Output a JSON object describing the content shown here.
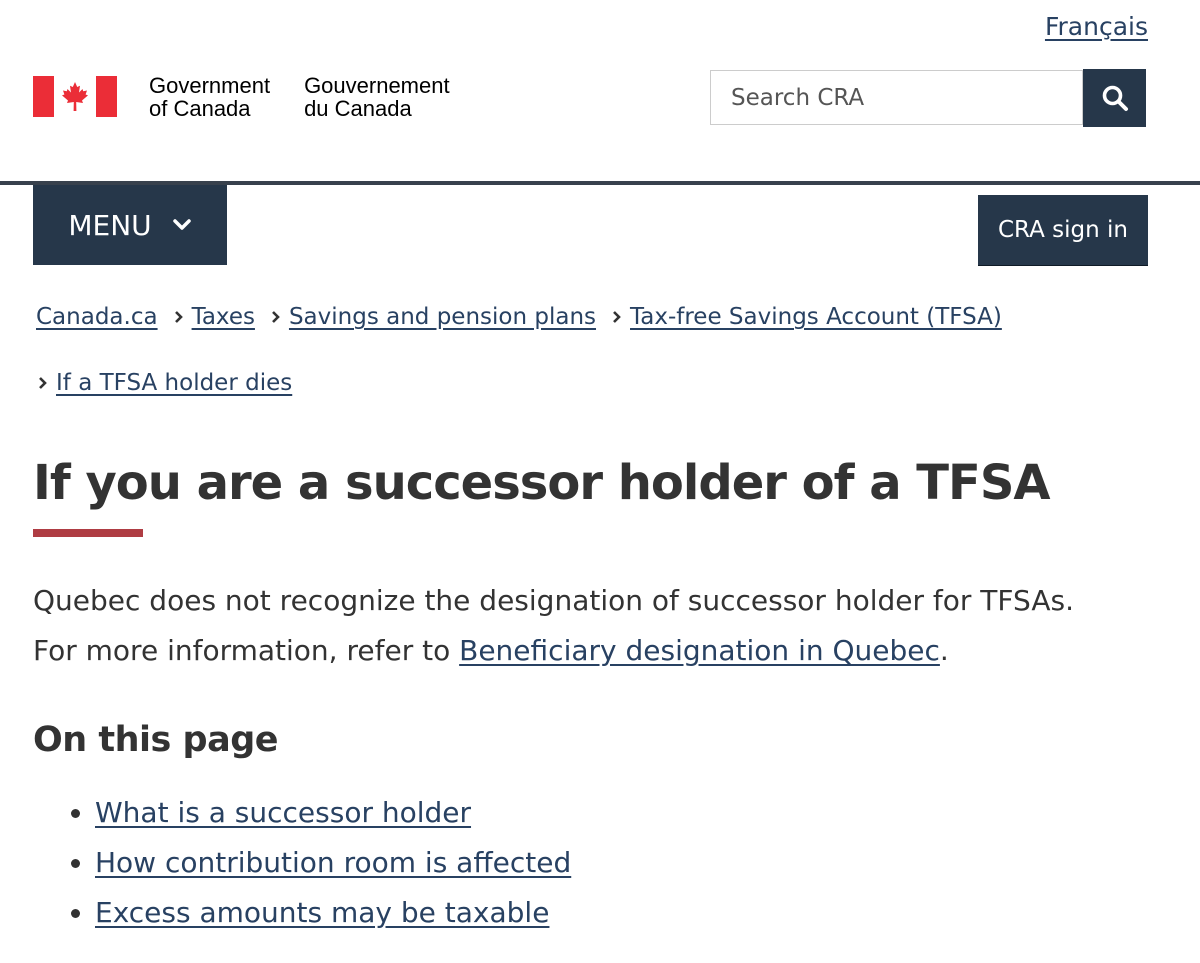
{
  "header": {
    "language_link": "Français",
    "signature_en_line1": "Government",
    "signature_en_line2": "of Canada",
    "signature_fr_line1": "Gouvernement",
    "signature_fr_line2": "du Canada",
    "search_placeholder": "Search CRA",
    "search_icon": "search-icon",
    "flag_color": "#eb2d37",
    "brand_color": "#26374a"
  },
  "nav": {
    "menu_label": "MENU",
    "signin_label": "CRA sign in"
  },
  "breadcrumb": [
    "Canada.ca",
    "Taxes",
    "Savings and pension plans",
    "Tax-free Savings Account (TFSA)",
    "If a TFSA holder dies"
  ],
  "main": {
    "title": "If you are a successor holder of a TFSA",
    "title_accent_color": "#af3c43",
    "intro_line1": "Quebec does not recognize the designation of successor holder for TFSAs.",
    "intro_prefix": "For more information, refer to ",
    "intro_link": "Beneficiary designation in Quebec",
    "intro_suffix": ".",
    "toc_heading": "On this page",
    "toc_items": [
      "What is a successor holder",
      "How contribution room is affected",
      "Excess amounts may be taxable"
    ]
  }
}
